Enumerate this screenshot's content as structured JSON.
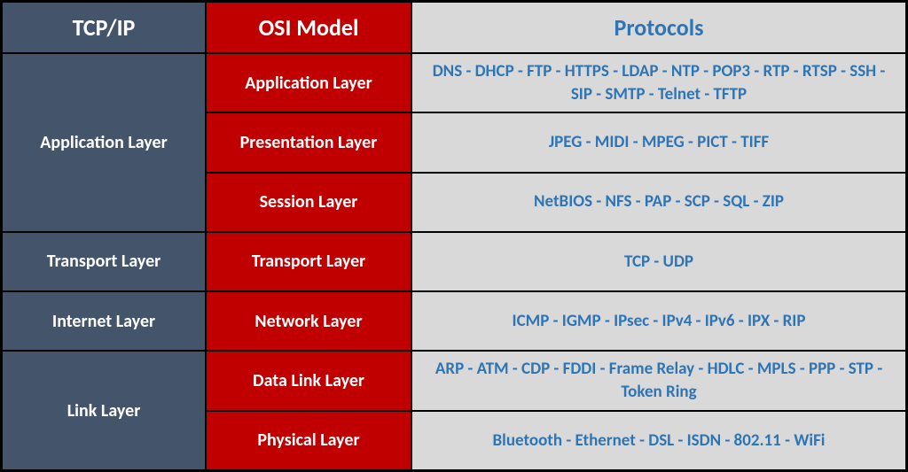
{
  "headers": {
    "tcpip": "TCP/IP",
    "osi": "OSI Model",
    "protocols": "Protocols"
  },
  "tcpip_layers": {
    "application": "Application Layer",
    "transport": "Transport Layer",
    "internet": "Internet Layer",
    "link": "Link Layer"
  },
  "osi_layers": {
    "application": "Application Layer",
    "presentation": "Presentation Layer",
    "session": "Session Layer",
    "transport": "Transport Layer",
    "network": "Network Layer",
    "datalink": "Data Link Layer",
    "physical": "Physical Layer"
  },
  "protocols": {
    "application": "DNS - DHCP - FTP - HTTPS - LDAP - NTP - POP3 - RTP - RTSP - SSH - SIP - SMTP - Telnet - TFTP",
    "presentation": "JPEG - MIDI - MPEG - PICT - TIFF",
    "session": "NetBIOS - NFS - PAP - SCP - SQL - ZIP",
    "transport": "TCP - UDP",
    "network": "ICMP - IGMP - IPsec - IPv4 - IPv6 - IPX - RIP",
    "datalink": "ARP - ATM - CDP - FDDI - Frame Relay - HDLC - MPLS - PPP  - STP - Token Ring",
    "physical": "Bluetooth - Ethernet - DSL - ISDN - 802.11 - WiFi"
  }
}
